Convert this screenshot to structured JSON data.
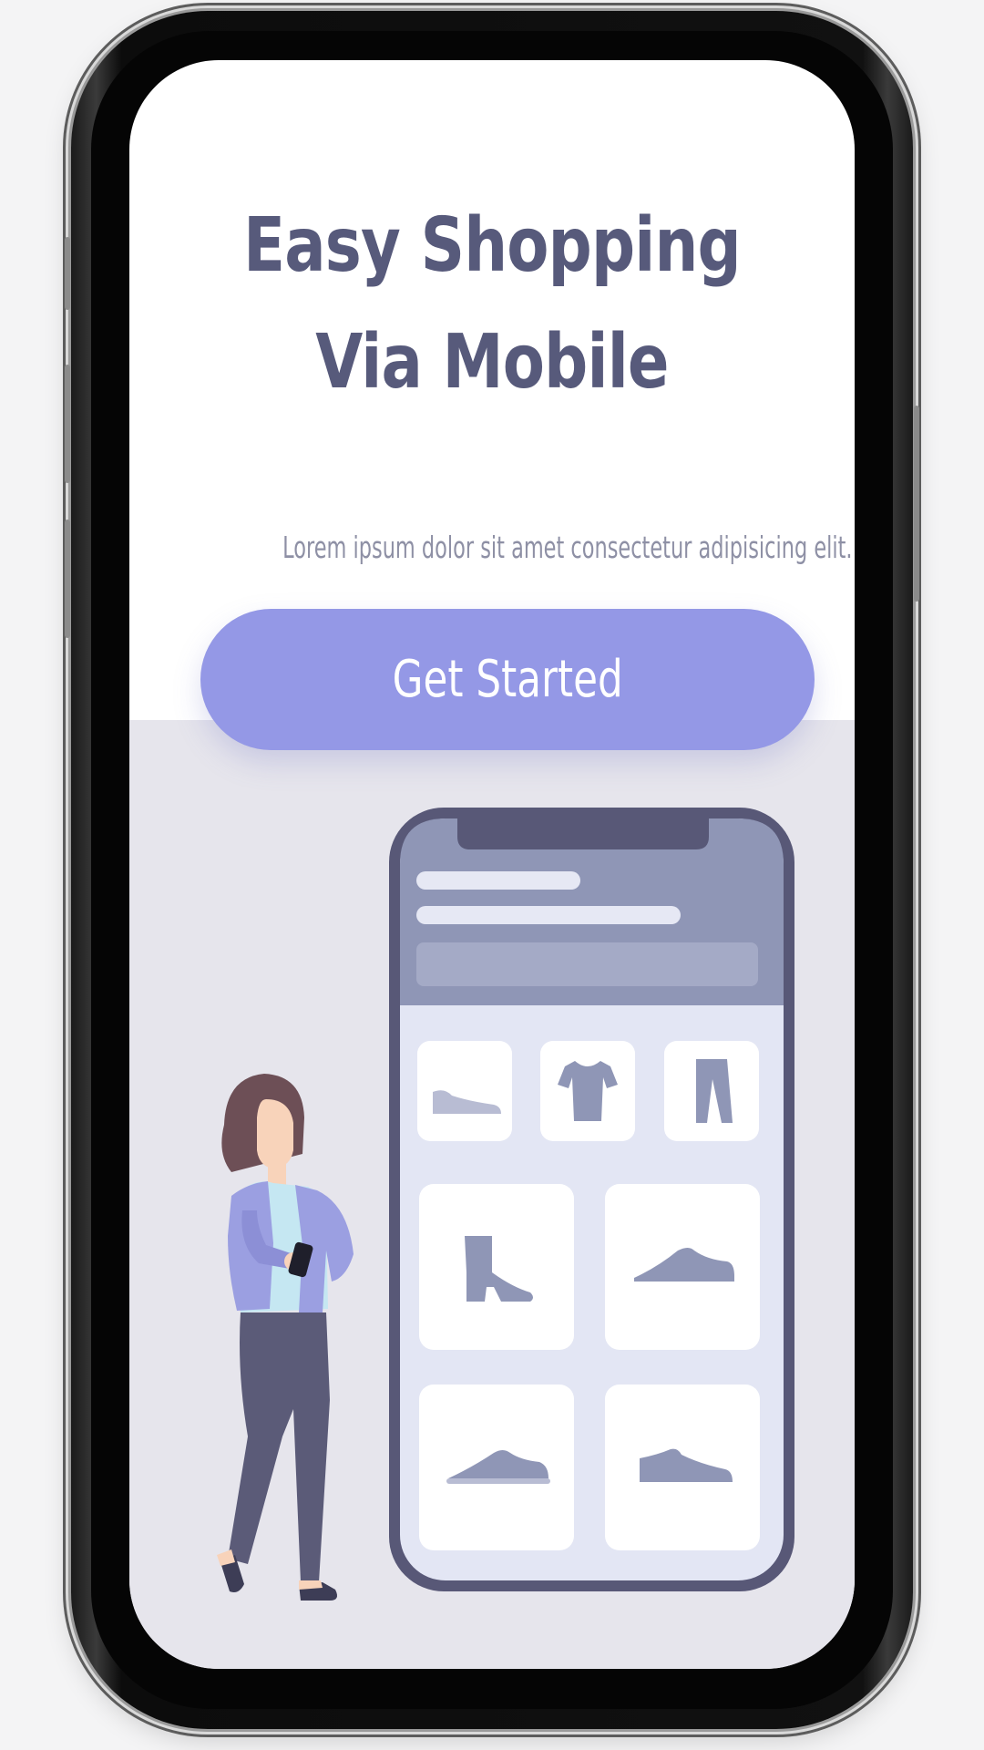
{
  "hero": {
    "title": "Easy Shopping Via Mobile",
    "subtitle": "Lorem ipsum dolor sit amet consectetur adipisicing elit.",
    "cta_label": "Get Started"
  },
  "illustration": {
    "products": [
      "shoe-icon",
      "tshirt-icon",
      "pants-icon",
      "boot-icon",
      "sneaker-icon",
      "sneaker-icon",
      "sneaker-icon"
    ]
  },
  "colors": {
    "title": "#575a7b",
    "subtitle": "#8e90a5",
    "accent": "#9498e6",
    "lower_background": "#e6e5ec",
    "device_frame": "#585877"
  }
}
